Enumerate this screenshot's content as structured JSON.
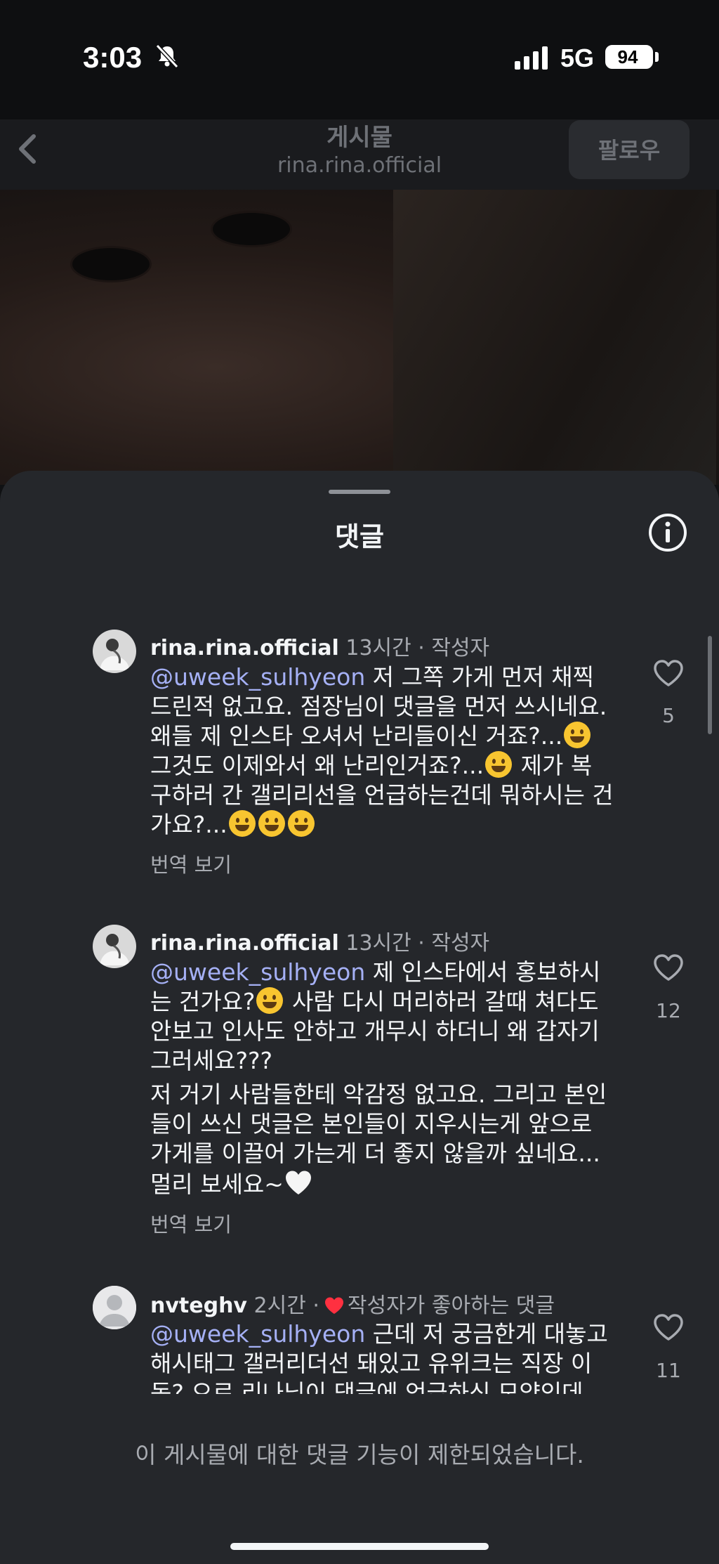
{
  "status_bar": {
    "time": "3:03",
    "network": "5G",
    "battery": "94"
  },
  "header": {
    "title": "게시물",
    "subtitle": "rina.rina.official",
    "follow_label": "팔로우"
  },
  "sheet": {
    "title": "댓글"
  },
  "comments": [
    {
      "username": "rina.rina.official",
      "meta": "13시간 · 작성자",
      "mention": "@uweek_sulhyeon",
      "lines": [
        " 저 그쪽 가게 먼저 채찍",
        "드린적 없고요. 점장님이 댓글을 먼저 쓰시네요.",
        "왜들 제 인스타 오셔서 난리들이신 거죠?...",
        "그것도 이제와서 왜 난리인거죠?...",
        " 제가 복",
        "구하러 간 갤리리선을 언급하는건데 뭐하시는 건",
        "가요?..."
      ],
      "translate": "번역 보기",
      "likes": "5"
    },
    {
      "username": "rina.rina.official",
      "meta": "13시간 · 작성자",
      "mention": "@uweek_sulhyeon",
      "lines": [
        " 제 인스타에서 홍보하시",
        "는 건가요?",
        " 사람 다시 머리하러 갈때 쳐다도",
        "안보고 인사도 안하고 개무시 하더니 왜 갑자기",
        "그러세요???"
      ],
      "paragraph2": [
        "저 거기 사람들한테 악감정 없고요. 그리고 본인",
        "들이 쓰신 댓글은 본인들이 지우시는게 앞으로",
        "가게를 이끌어 가는게 더 좋지 않을까 싶네요...",
        "멀리 보세요~"
      ],
      "translate": "번역 보기",
      "likes": "12"
    },
    {
      "username": "nvteghv",
      "meta": "2시간 ·",
      "liked_by_author": "작성자가 좋아하는 댓글",
      "mention": "@uweek_sulhyeon",
      "lines": [
        " 근데 저 궁금한게 대놓고",
        "해시태그 갤러리더선 돼있고 유위크는 직장 이",
        "동? 으로 리나님이 댓글에 언급하신 모양인데"
      ],
      "likes": "11"
    }
  ],
  "footer": {
    "restricted_text": "이 게시물에 대한 댓글 기능이 제한되었습니다."
  },
  "colors": {
    "background": "#25272b",
    "mention": "#a5b0f5",
    "meta": "#a8abb1",
    "liked_heart": "#ff3040"
  }
}
